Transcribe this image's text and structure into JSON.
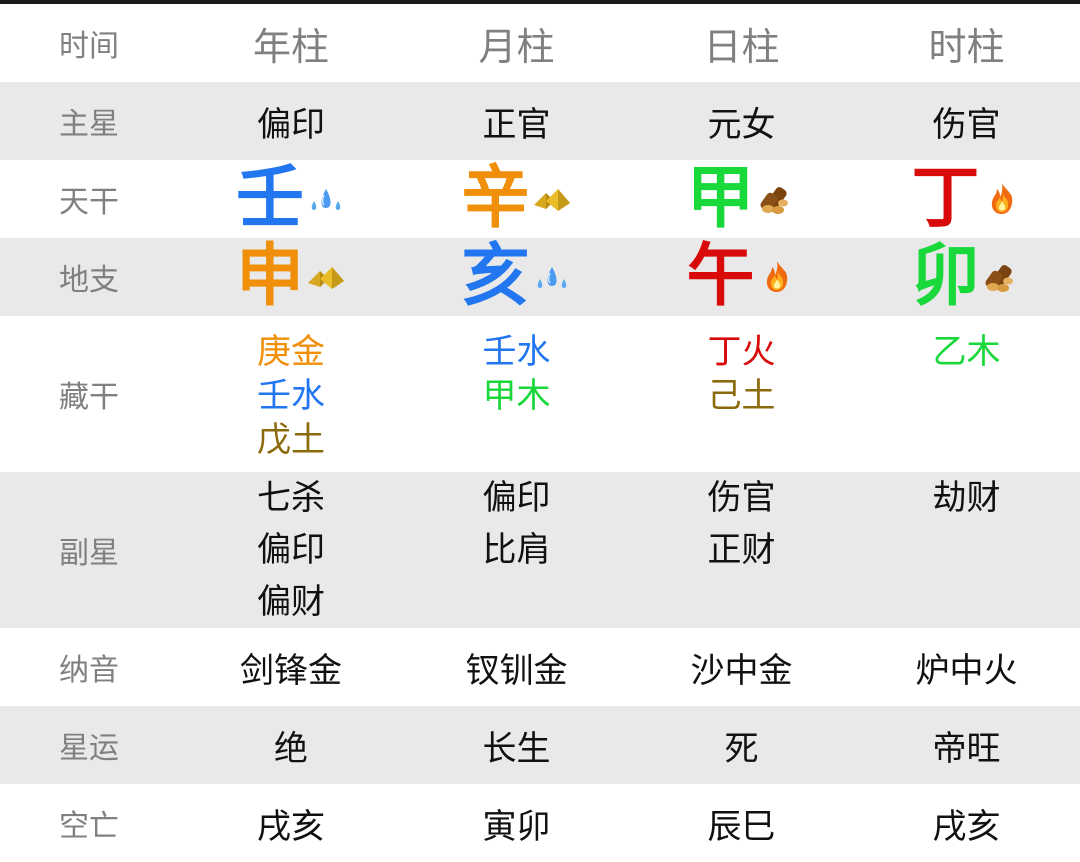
{
  "header": {
    "label": "时间",
    "columns": [
      "年柱",
      "月柱",
      "日柱",
      "时柱"
    ]
  },
  "rows": {
    "zhuxing": {
      "label": "主星",
      "values": [
        "偏印",
        "正官",
        "元女",
        "伤官"
      ]
    },
    "tiangan": {
      "label": "天干",
      "values": [
        {
          "char": "壬",
          "element": "water",
          "icon": "water-drops-icon",
          "color": "#2276f0"
        },
        {
          "char": "辛",
          "element": "metal",
          "icon": "gold-ingot-icon",
          "color": "#f0900a"
        },
        {
          "char": "甲",
          "element": "wood",
          "icon": "wood-logs-icon",
          "color": "#18d83a"
        },
        {
          "char": "丁",
          "element": "fire",
          "icon": "fire-icon",
          "color": "#d80a0a"
        }
      ]
    },
    "dizhi": {
      "label": "地支",
      "values": [
        {
          "char": "申",
          "element": "metal",
          "icon": "gold-ingot-icon",
          "color": "#f0900a"
        },
        {
          "char": "亥",
          "element": "water",
          "icon": "water-drops-icon",
          "color": "#2276f0"
        },
        {
          "char": "午",
          "element": "fire",
          "icon": "fire-icon",
          "color": "#d80a0a"
        },
        {
          "char": "卯",
          "element": "wood",
          "icon": "wood-logs-icon",
          "color": "#18d83a"
        }
      ]
    },
    "canggan": {
      "label": "藏干",
      "values": [
        [
          {
            "text": "庚金",
            "color": "#f0900a"
          },
          {
            "text": "壬水",
            "color": "#2276f0"
          },
          {
            "text": "戊土",
            "color": "#8b6a0c"
          }
        ],
        [
          {
            "text": "壬水",
            "color": "#2276f0"
          },
          {
            "text": "甲木",
            "color": "#18d83a"
          }
        ],
        [
          {
            "text": "丁火",
            "color": "#d80a0a"
          },
          {
            "text": "己土",
            "color": "#8b6a0c"
          }
        ],
        [
          {
            "text": "乙木",
            "color": "#18d83a"
          }
        ]
      ]
    },
    "fuxing": {
      "label": "副星",
      "values": [
        [
          "七杀",
          "偏印",
          "偏财"
        ],
        [
          "偏印",
          "比肩"
        ],
        [
          "伤官",
          "正财"
        ],
        [
          "劫财"
        ]
      ]
    },
    "nayin": {
      "label": "纳音",
      "values": [
        "剑锋金",
        "钗钏金",
        "沙中金",
        "炉中火"
      ]
    },
    "xingyun": {
      "label": "星运",
      "values": [
        "绝",
        "长生",
        "死",
        "帝旺"
      ]
    },
    "kongwang": {
      "label": "空亡",
      "values": [
        "戌亥",
        "寅卯",
        "辰巳",
        "戌亥"
      ]
    }
  },
  "colors": {
    "metal": "#f0900a",
    "water": "#2276f0",
    "wood": "#18d83a",
    "fire": "#d80a0a",
    "earth": "#8b6a0c",
    "label_gray": "#808080",
    "row_gray": "#e9e9e9"
  }
}
